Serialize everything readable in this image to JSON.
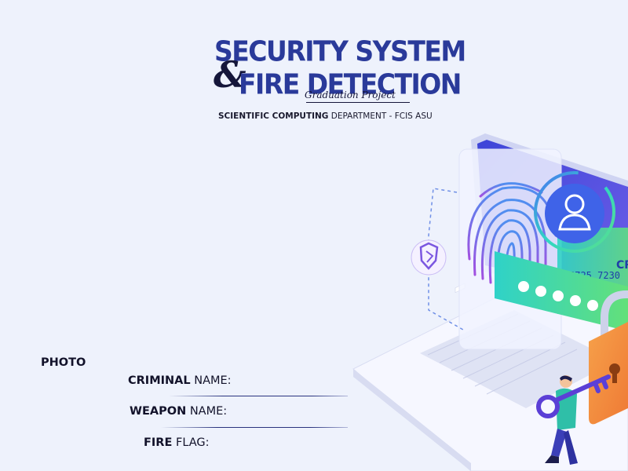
{
  "header": {
    "title_line1": "SECURITY SYSTEM",
    "ampersand": "&",
    "title_line2": "FIRE DETECTION",
    "subtitle": "Graduation Project",
    "department_bold": "SCIENTIFIC COMPUTING",
    "department_rest": " DEPARTMENT - FCIS ASU"
  },
  "form": {
    "photo_label": "PHOTO",
    "criminal": {
      "bold": "CRIMINAL",
      "rest": " NAME:"
    },
    "weapon": {
      "bold": "WEAPON",
      "rest": " NAME:"
    },
    "fire": {
      "bold": "FIRE",
      "rest": " FLAG:"
    }
  },
  "illustration": {
    "card_number": "5725 7230",
    "card_partial": "CR",
    "icons": [
      "fingerprint-icon",
      "user-icon",
      "shield-icon",
      "padlock-icon",
      "key-icon"
    ],
    "colors": {
      "accent": "#2a3a9a",
      "fingerprint": "#7b57e0",
      "lock": "#f28b3b",
      "card": "#2dd3c8"
    }
  }
}
